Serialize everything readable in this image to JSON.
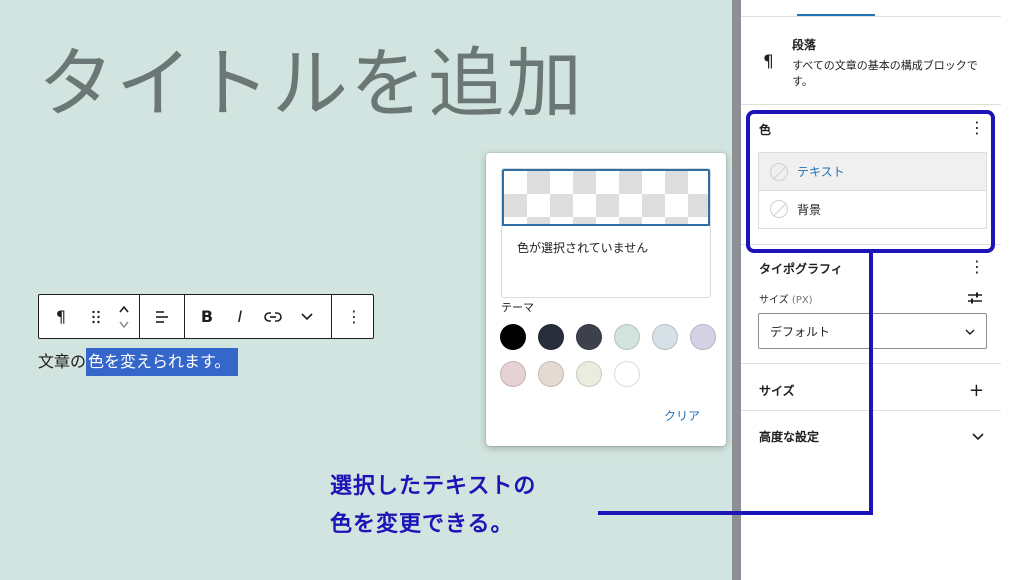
{
  "editor": {
    "title": "タイトルを追加",
    "paragraph_plain": "文章の",
    "paragraph_selected": "色を変えられます。"
  },
  "toolbar": {
    "paragraph_icon": "¶",
    "bold": "B",
    "italic": "I",
    "more": "⋮"
  },
  "popover": {
    "no_color_text": "色が選択されていません",
    "theme_label": "テーマ",
    "clear_label": "クリア",
    "swatches": [
      "#000000",
      "#282d3c",
      "#3c414b",
      "#d2e4df",
      "#d6e0e6",
      "#d4d2e4",
      "#e6d2d5",
      "#e4dad2",
      "#ecebdf",
      "#ffffff"
    ]
  },
  "sidebar": {
    "block_icon": "¶",
    "block_name": "段落",
    "block_desc": "すべての文章の基本の構成ブロックです。",
    "color_panel_title": "色",
    "color_items": [
      "テキスト",
      "背景"
    ],
    "typography_title": "タイポグラフィ",
    "size_label": "サイズ",
    "size_unit": "(PX)",
    "size_select_value": "デフォルト",
    "size_section": "サイズ",
    "advanced_section": "高度な設定",
    "kebab": "⋮",
    "plus": "+",
    "chevron": "⌄"
  },
  "annotation": {
    "line1": "選択したテキストの",
    "line2": "色を変更できる。",
    "color": "#1c14b6"
  },
  "colors": {
    "canvas_bg": "#d2e4df",
    "selection": "#3566c9",
    "accent": "#2271b1"
  }
}
